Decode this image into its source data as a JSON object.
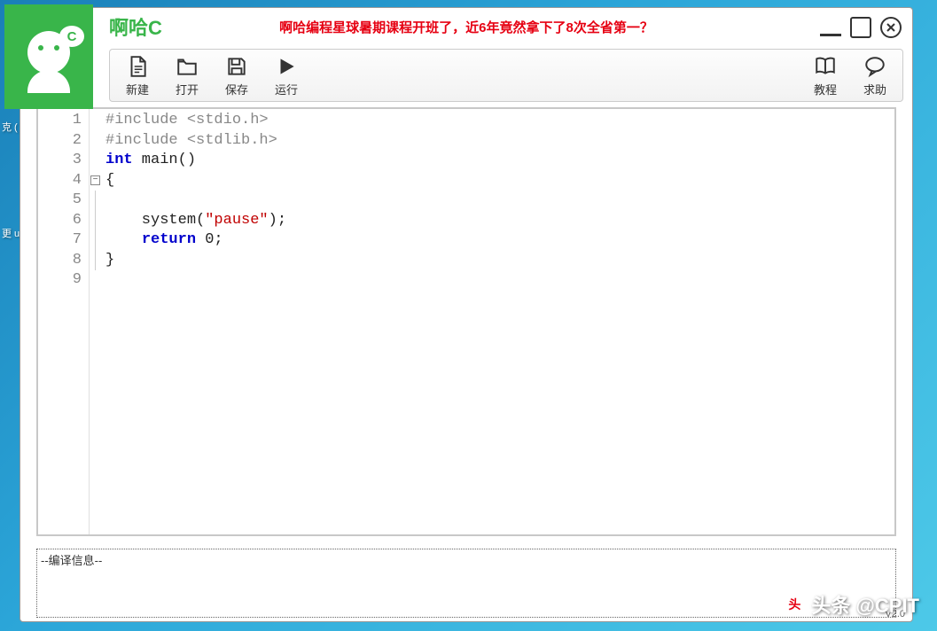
{
  "app": {
    "title": "啊哈C",
    "logo_letter": "C",
    "banner": "啊哈编程星球暑期课程开班了，近6年竟然拿下了8次全省第一？",
    "version": "V2.0"
  },
  "toolbar": {
    "new_label": "新建",
    "open_label": "打开",
    "save_label": "保存",
    "run_label": "运行",
    "tutorial_label": "教程",
    "help_label": "求助"
  },
  "editor": {
    "lines": [
      {
        "num": "1",
        "tokens": [
          {
            "cls": "pp",
            "t": "#include <stdio.h>"
          }
        ]
      },
      {
        "num": "2",
        "tokens": [
          {
            "cls": "pp",
            "t": "#include <stdlib.h>"
          }
        ]
      },
      {
        "num": "3",
        "tokens": [
          {
            "cls": "kw",
            "t": "int"
          },
          {
            "cls": "txt",
            "t": " main()"
          }
        ]
      },
      {
        "num": "4",
        "tokens": [
          {
            "cls": "txt",
            "t": "{"
          }
        ]
      },
      {
        "num": "5",
        "tokens": []
      },
      {
        "num": "6",
        "tokens": [
          {
            "cls": "txt",
            "t": "    system("
          },
          {
            "cls": "str",
            "t": "\"pause\""
          },
          {
            "cls": "txt",
            "t": ");"
          }
        ]
      },
      {
        "num": "7",
        "tokens": [
          {
            "cls": "txt",
            "t": "    "
          },
          {
            "cls": "kw",
            "t": "return"
          },
          {
            "cls": "txt",
            "t": " 0;"
          }
        ]
      },
      {
        "num": "8",
        "tokens": [
          {
            "cls": "txt",
            "t": "}"
          }
        ]
      },
      {
        "num": "9",
        "tokens": []
      }
    ],
    "fold_marker_line": 4
  },
  "output": {
    "title": "--编译信息--"
  },
  "watermark": {
    "text": "头条 @CPIT",
    "logo": "头"
  },
  "desktop": {
    "frag1": "克 (",
    "frag2": "更 u"
  }
}
